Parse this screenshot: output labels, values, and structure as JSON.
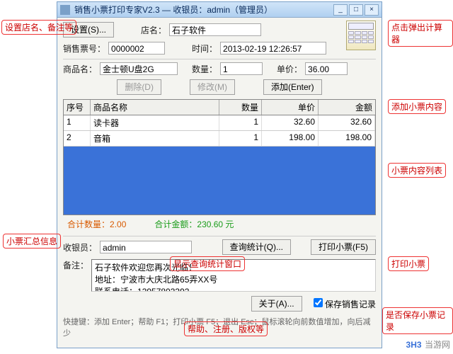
{
  "title": "销售小票打印专家V2.3 — 收银员：admin（管理员）",
  "buttons": {
    "settings": "设置(S)...",
    "delete": "删除(D)",
    "modify": "修改(M)",
    "add": "添加(Enter)",
    "query": "查询统计(Q)...",
    "print": "打印小票(F5)",
    "about": "关于(A)..."
  },
  "labels": {
    "shop": "店名：",
    "saleno": "销售票号：",
    "time": "时间：",
    "prod": "商品名：",
    "qty": "数量：",
    "price": "单价：",
    "cashier": "收银员：",
    "remark": "备注：",
    "save": "保存销售记录",
    "hint": "快捷键：添加 Enter；帮助 F1；打印小票 F5；退出 Esc；鼠标滚轮向前数值增加，向后减少"
  },
  "values": {
    "shop": "石子软件",
    "saleno": "0000002",
    "time": "2013-02-19 12:26:57",
    "prod": "金士顿U盘2G",
    "qty": "1",
    "price": "36.00",
    "cashier": "admin",
    "remark": "石子软件欢迎您再次光临！\n地址：宁波市大庆北路65弄XX号\n联系电话：13957803392"
  },
  "columns": {
    "idx": "序号",
    "name": "商品名称",
    "qty": "数量",
    "price": "单价",
    "amt": "金额"
  },
  "rows": [
    {
      "idx": "1",
      "name": "读卡器",
      "qty": "1",
      "price": "32.60",
      "amt": "32.60"
    },
    {
      "idx": "2",
      "name": "音箱",
      "qty": "1",
      "price": "198.00",
      "amt": "198.00"
    }
  ],
  "summary": {
    "qty_lbl": "合计数量：",
    "qty": "2.00",
    "amt_lbl": "合计金额：",
    "amt": "230.60 元"
  },
  "annotations": {
    "a1": "设置店名、备注等",
    "a2": "点击弹出计算器",
    "a3": "添加小票内容",
    "a4": "小票内容列表",
    "a5": "小票汇总信息",
    "a6": "显示查询统计窗口",
    "a7": "打印小票",
    "a8": "帮助、注册、版权等",
    "a9": "是否保存小票记录"
  },
  "watermark": {
    "brand": "3H3",
    "site": "当游网"
  }
}
